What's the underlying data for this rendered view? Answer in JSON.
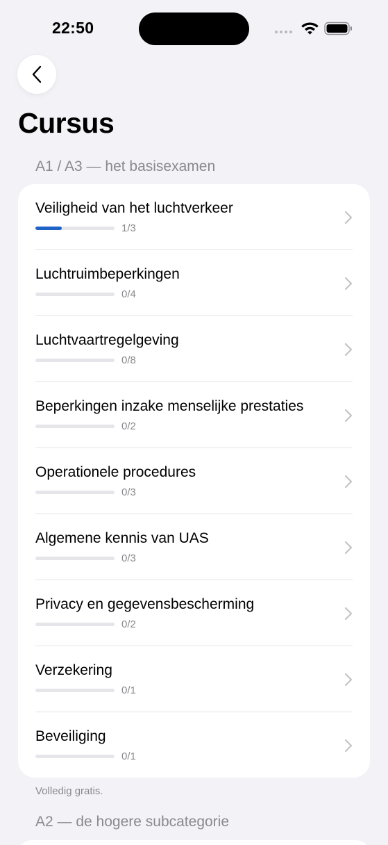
{
  "status_bar": {
    "time": "22:50"
  },
  "navigation": {
    "back_icon": "chevron-left-icon"
  },
  "page_title": "Cursus",
  "sections": [
    {
      "header": "A1 / A3 — het basisexamen",
      "footnote": "Volledig gratis.",
      "items": [
        {
          "title": "Veiligheid van het luchtverkeer",
          "completed": 1,
          "total": 3,
          "progress_text": "1/3"
        },
        {
          "title": "Luchtruimbeperkingen",
          "completed": 0,
          "total": 4,
          "progress_text": "0/4"
        },
        {
          "title": "Luchtvaartregelgeving",
          "completed": 0,
          "total": 8,
          "progress_text": "0/8"
        },
        {
          "title": "Beperkingen inzake menselijke prestaties",
          "completed": 0,
          "total": 2,
          "progress_text": "0/2"
        },
        {
          "title": "Operationele procedures",
          "completed": 0,
          "total": 3,
          "progress_text": "0/3"
        },
        {
          "title": "Algemene kennis van UAS",
          "completed": 0,
          "total": 3,
          "progress_text": "0/3"
        },
        {
          "title": "Privacy en gegevensbescherming",
          "completed": 0,
          "total": 2,
          "progress_text": "0/2"
        },
        {
          "title": "Verzekering",
          "completed": 0,
          "total": 1,
          "progress_text": "0/1"
        },
        {
          "title": "Beveiliging",
          "completed": 0,
          "total": 1,
          "progress_text": "0/1"
        }
      ]
    },
    {
      "header": "A2 — de hogere subcategorie"
    }
  ],
  "colors": {
    "accent": "#1f63c6",
    "background": "#f2f2f7",
    "secondary_text": "#8a8a8e",
    "track": "#e5e5ea"
  }
}
